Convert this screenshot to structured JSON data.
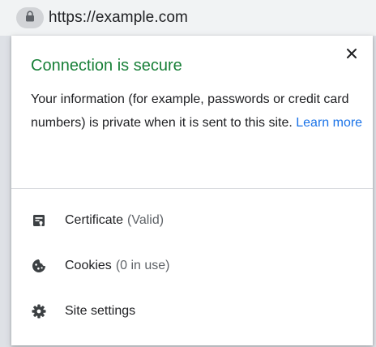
{
  "address_bar": {
    "url": "https://example.com",
    "lock_icon": "lock-icon"
  },
  "popup": {
    "title": "Connection is secure",
    "description": "Your information (for example, passwords or credit card numbers) is private when it is sent to this site.",
    "learn_more": "Learn more",
    "close_icon": "close-icon",
    "items": [
      {
        "label": "Certificate",
        "detail": "(Valid)",
        "icon": "certificate-icon"
      },
      {
        "label": "Cookies",
        "detail": "(0 in use)",
        "icon": "cookie-icon"
      },
      {
        "label": "Site settings",
        "detail": "",
        "icon": "gear-icon"
      }
    ]
  },
  "colors": {
    "secure_green": "#188038",
    "link_blue": "#1a73e8",
    "text": "#202124",
    "muted": "#5f6368"
  }
}
